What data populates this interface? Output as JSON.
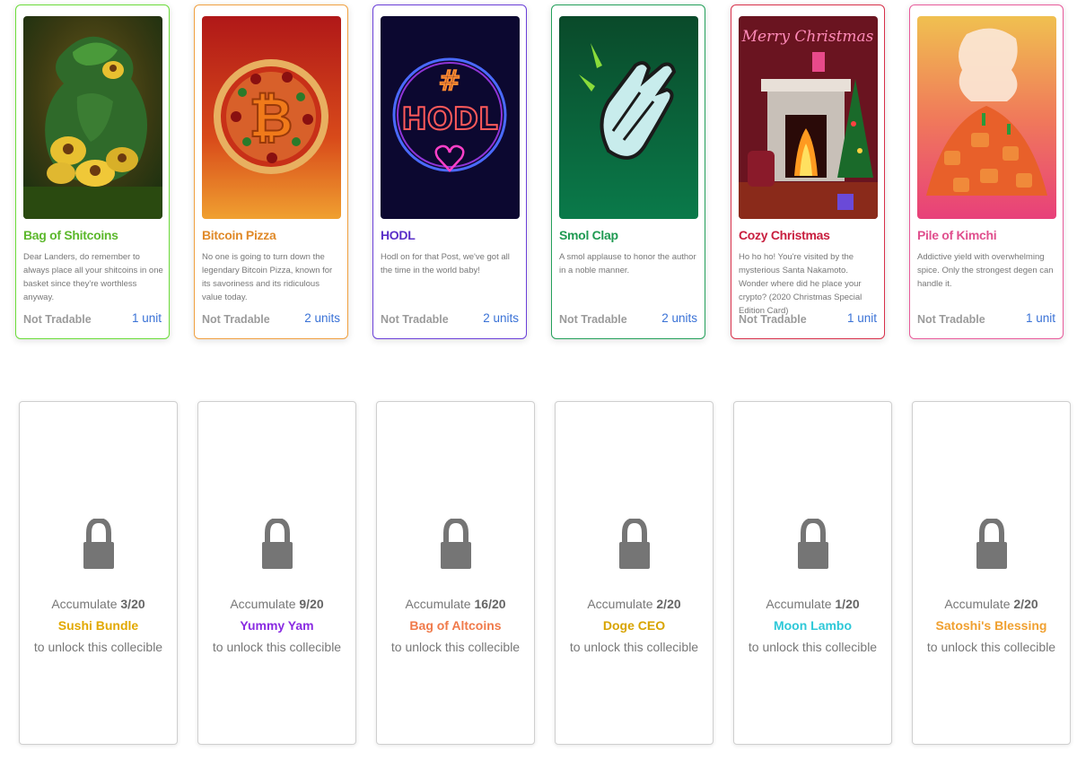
{
  "cards": [
    {
      "title": "Bag of Shitcoins",
      "description": "Dear Landers, do remember to always place all your shitcoins in one basket since they're worthless anyway.",
      "tradable": "Not Tradable",
      "units": "1 unit",
      "border_color": "#6bdc3a",
      "title_color": "#5cb82c",
      "art_icon": "shitcoin-bag-art"
    },
    {
      "title": "Bitcoin Pizza",
      "description": "No one is going to turn down the legendary Bitcoin Pizza, known for its savoriness and its ridiculous value today.",
      "tradable": "Not Tradable",
      "units": "2 units",
      "border_color": "#f0a040",
      "title_color": "#e08a2a",
      "art_icon": "bitcoin-pizza-art"
    },
    {
      "title": "HODL",
      "description": "Hodl on for that Post, we've got all the time in the world baby!",
      "tradable": "Not Tradable",
      "units": "2 units",
      "border_color": "#6a3fd8",
      "title_color": "#5a2fc8",
      "art_icon": "hodl-neon-art"
    },
    {
      "title": "Smol Clap",
      "description": "A smol applause to honor the author in a noble manner.",
      "tradable": "Not Tradable",
      "units": "2 units",
      "border_color": "#23a05a",
      "title_color": "#1f9a52",
      "art_icon": "clapping-hands-art"
    },
    {
      "title": "Cozy Christmas",
      "description": "Ho ho ho! You're visited by the mysterious Santa Nakamoto. Wonder where did he place your crypto? (2020 Christmas Special Edition Card)",
      "tradable": "Not Tradable",
      "units": "1 unit",
      "border_color": "#d8304a",
      "title_color": "#c81e3e",
      "art_icon": "christmas-fireplace-art"
    },
    {
      "title": "Pile of Kimchi",
      "description": "Addictive yield with overwhelming spice. Only the strongest degen can handle it.",
      "tradable": "Not Tradable",
      "units": "1 unit",
      "border_color": "#e85a9a",
      "title_color": "#e0508e",
      "art_icon": "kimchi-pile-art"
    }
  ],
  "locked": [
    {
      "accumulate": "Accumulate",
      "progress": "3/20",
      "name": "Sushi Bundle",
      "name_color": "#e2a800",
      "suffix": "to unlock this collecible",
      "icon": "lock-icon"
    },
    {
      "accumulate": "Accumulate",
      "progress": "9/20",
      "name": "Yummy Yam",
      "name_color": "#8a2be2",
      "suffix": "to unlock this collecible",
      "icon": "lock-icon"
    },
    {
      "accumulate": "Accumulate",
      "progress": "16/20",
      "name": "Bag of Altcoins",
      "name_color": "#f07a4a",
      "suffix": "to unlock this collecible",
      "icon": "lock-icon"
    },
    {
      "accumulate": "Accumulate",
      "progress": "2/20",
      "name": "Doge CEO",
      "name_color": "#d8a400",
      "suffix": "to unlock this collecible",
      "icon": "lock-icon"
    },
    {
      "accumulate": "Accumulate",
      "progress": "1/20",
      "name": "Moon Lambo",
      "name_color": "#2ec8d8",
      "suffix": "to unlock this collecible",
      "icon": "lock-icon"
    },
    {
      "accumulate": "Accumulate",
      "progress": "2/20",
      "name": "Satoshi's Blessing",
      "name_color": "#f0a030",
      "suffix": "to unlock this collecible",
      "icon": "lock-icon"
    }
  ],
  "art_text": {
    "hodl_hash": "#",
    "hodl_word": "HODL",
    "bitcoin_symbol": "₿",
    "christmas_banner": "Merry Christmas"
  }
}
